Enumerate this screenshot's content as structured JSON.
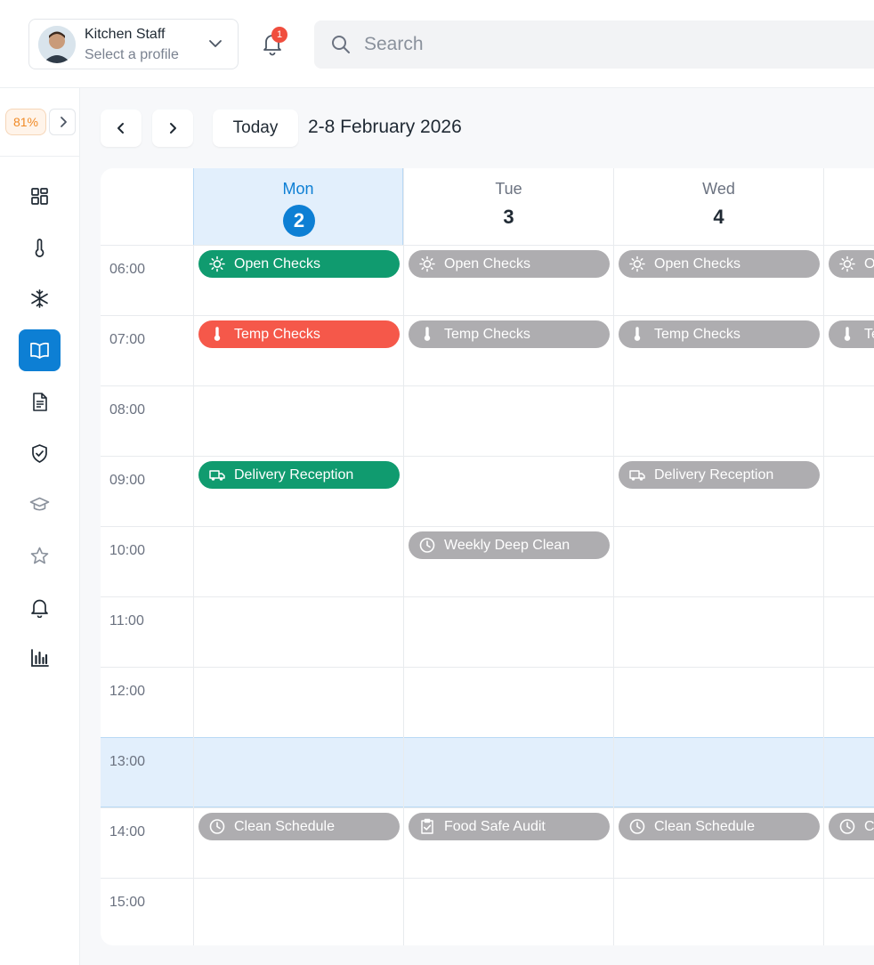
{
  "header": {
    "profile": {
      "name": "Kitchen Staff",
      "subtitle": "Select a profile"
    },
    "notifications": {
      "count": "1"
    },
    "search": {
      "placeholder": "Search"
    }
  },
  "sidebar": {
    "progress": "81%",
    "items": [
      {
        "icon": "dashboard-icon",
        "active": false
      },
      {
        "icon": "thermometer-icon",
        "active": false
      },
      {
        "icon": "snowflake-icon",
        "active": false
      },
      {
        "icon": "book-icon",
        "active": true
      },
      {
        "icon": "document-icon",
        "active": false
      },
      {
        "icon": "shield-check-icon",
        "active": false
      },
      {
        "icon": "graduation-cap-icon",
        "active": false
      },
      {
        "icon": "star-icon",
        "active": false
      },
      {
        "icon": "bell-icon",
        "active": false
      },
      {
        "icon": "bar-chart-icon",
        "active": false
      }
    ]
  },
  "toolbar": {
    "today_label": "Today",
    "week_title": "2-8 February 2026"
  },
  "calendar": {
    "days": [
      {
        "name": "Mon",
        "number": "2",
        "today": true
      },
      {
        "name": "Tue",
        "number": "3",
        "today": false
      },
      {
        "name": "Wed",
        "number": "4",
        "today": false
      },
      {
        "name": "",
        "number": "",
        "today": false
      }
    ],
    "hours": [
      "06:00",
      "07:00",
      "08:00",
      "09:00",
      "10:00",
      "11:00",
      "12:00",
      "13:00",
      "14:00",
      "15:00"
    ],
    "current_hour": "13:00",
    "events": [
      {
        "day": 0,
        "hour": 0,
        "label": "Open Checks",
        "icon": "sun-icon",
        "status": "green"
      },
      {
        "day": 1,
        "hour": 0,
        "label": "Open Checks",
        "icon": "sun-icon",
        "status": "gray"
      },
      {
        "day": 2,
        "hour": 0,
        "label": "Open Checks",
        "icon": "sun-icon",
        "status": "gray"
      },
      {
        "day": 3,
        "hour": 0,
        "label": "Open Checks",
        "icon": "sun-icon",
        "status": "gray"
      },
      {
        "day": 0,
        "hour": 1,
        "label": "Temp Checks",
        "icon": "thermometer-icon",
        "status": "red"
      },
      {
        "day": 1,
        "hour": 1,
        "label": "Temp Checks",
        "icon": "thermometer-icon",
        "status": "gray"
      },
      {
        "day": 2,
        "hour": 1,
        "label": "Temp Checks",
        "icon": "thermometer-icon",
        "status": "gray"
      },
      {
        "day": 3,
        "hour": 1,
        "label": "Temp Checks",
        "icon": "thermometer-icon",
        "status": "gray"
      },
      {
        "day": 0,
        "hour": 3,
        "label": "Delivery Reception",
        "icon": "truck-icon",
        "status": "green"
      },
      {
        "day": 2,
        "hour": 3,
        "label": "Delivery Reception",
        "icon": "truck-icon",
        "status": "gray"
      },
      {
        "day": 1,
        "hour": 4,
        "label": "Weekly Deep Clean",
        "icon": "clock-icon",
        "status": "gray"
      },
      {
        "day": 0,
        "hour": 8,
        "label": "Clean Schedule",
        "icon": "clock-icon",
        "status": "gray"
      },
      {
        "day": 1,
        "hour": 8,
        "label": "Food Safe Audit",
        "icon": "clipboard-check-icon",
        "status": "gray"
      },
      {
        "day": 2,
        "hour": 8,
        "label": "Clean Schedule",
        "icon": "clock-icon",
        "status": "gray"
      },
      {
        "day": 3,
        "hour": 8,
        "label": "Clean Schedule",
        "icon": "clock-icon",
        "status": "gray"
      }
    ]
  },
  "colors": {
    "accent": "#0d7fd4",
    "success": "#109b6f",
    "danger": "#f5584a",
    "pending": "#aeadb0",
    "today_bg": "#e2effc"
  }
}
